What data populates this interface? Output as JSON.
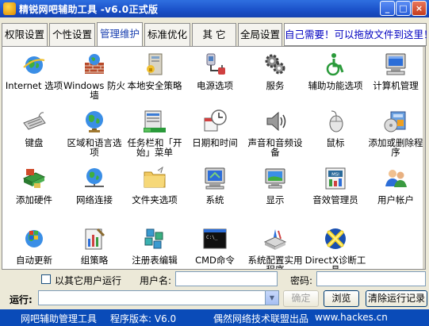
{
  "window": {
    "title": "精锐网吧辅助工具  -v6.0正式版",
    "controls": [
      "_",
      "□",
      "×"
    ]
  },
  "tabs": [
    {
      "label": "权限设置",
      "active": false
    },
    {
      "label": "个性设置",
      "active": false
    },
    {
      "label": "管理维护",
      "active": true
    },
    {
      "label": "标准优化",
      "active": false
    },
    {
      "label": "其  它",
      "active": false
    },
    {
      "label": "全局设置",
      "active": false
    }
  ],
  "hint": "自己需要！可以拖放文件到这里！",
  "items": [
    {
      "label": "Internet 选项",
      "icon": "internet-options-icon"
    },
    {
      "label": "Windows 防火墙",
      "icon": "firewall-icon"
    },
    {
      "label": "本地安全策略",
      "icon": "security-policy-icon"
    },
    {
      "label": "电源选项",
      "icon": "power-options-icon"
    },
    {
      "label": "服务",
      "icon": "services-icon"
    },
    {
      "label": "辅助功能选项",
      "icon": "accessibility-icon"
    },
    {
      "label": "计算机管理",
      "icon": "computer-management-icon"
    },
    {
      "label": "键盘",
      "icon": "keyboard-icon"
    },
    {
      "label": "区域和语言选项",
      "icon": "region-language-icon"
    },
    {
      "label": "任务栏和「开始」菜单",
      "icon": "taskbar-icon"
    },
    {
      "label": "日期和时间",
      "icon": "date-time-icon"
    },
    {
      "label": "声音和音频设备",
      "icon": "sound-icon"
    },
    {
      "label": "鼠标",
      "icon": "mouse-icon"
    },
    {
      "label": "添加或删除程序",
      "icon": "add-remove-programs-icon"
    },
    {
      "label": "添加硬件",
      "icon": "add-hardware-icon"
    },
    {
      "label": "网络连接",
      "icon": "network-icon"
    },
    {
      "label": "文件夹选项",
      "icon": "folder-options-icon"
    },
    {
      "label": "系统",
      "icon": "system-icon"
    },
    {
      "label": "显示",
      "icon": "display-icon"
    },
    {
      "label": "音效管理员",
      "icon": "audio-manager-icon"
    },
    {
      "label": "用户帐户",
      "icon": "user-accounts-icon"
    },
    {
      "label": "自动更新",
      "icon": "auto-update-icon"
    },
    {
      "label": "组策略",
      "icon": "group-policy-icon"
    },
    {
      "label": "注册表编辑",
      "icon": "registry-editor-icon"
    },
    {
      "label": "CMD命令",
      "icon": "cmd-icon"
    },
    {
      "label": "系统配置实用程序",
      "icon": "system-config-icon"
    },
    {
      "label": "DirectX诊断工具",
      "icon": "directx-icon"
    }
  ],
  "form": {
    "run_as_label": "以其它用户运行",
    "username_label": "用户名:",
    "username_value": "",
    "password_label": "密码:",
    "password_value": "",
    "run_label": "运行:",
    "run_value": "",
    "ok_label": "确定",
    "browse_label": "浏览",
    "clear_label": "清除运行记录"
  },
  "status": {
    "left": "网吧辅助管理工具",
    "version": "程序版本: V6.0",
    "org": "偶然网络技术联盟出品",
    "url": "www.hackes.cn"
  }
}
